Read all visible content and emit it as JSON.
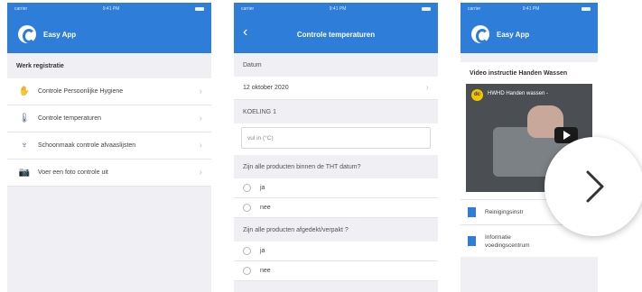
{
  "status": {
    "carrier": "carrier",
    "time": "9:41 PM"
  },
  "screen1": {
    "app_title": "Easy App",
    "section_header": "Werk registratie",
    "items": [
      {
        "label": "Controle Persoonlijke Hygiene",
        "icon": "hygiene-icon"
      },
      {
        "label": "Controle temperaturen",
        "icon": "thermometer-icon"
      },
      {
        "label": "Schoonmaak controle afvaaslijsten",
        "icon": "cleaning-icon"
      },
      {
        "label": "Voer een foto controle uit",
        "icon": "camera-icon"
      }
    ]
  },
  "screen2": {
    "nav_title": "Controle temperaturen",
    "datum_label": "Datum",
    "datum_value": "12 oktober 2020",
    "koeling_label": "KOELING 1",
    "koeling_placeholder": "vul in (°C)",
    "question1": "Zijn alle producten binnen de THT datum?",
    "options1": [
      "ja",
      "nee"
    ],
    "question2": "Zijn alle producten afgedekt/verpakt ?",
    "options2": [
      "ja",
      "nee"
    ]
  },
  "screen3": {
    "app_title": "Easy App",
    "card_title": "Video instructie Handen Wassen",
    "video_title": "HWHD Handen wassen -",
    "video_logo": "dc",
    "docs": [
      "Reinigingsinstr",
      "Informatie\nvoedingscentrum"
    ]
  },
  "colors": {
    "brand": "#2e7dd8",
    "background": "#efeff4"
  },
  "icons": {
    "back": "chevron-left-icon",
    "next": "chevron-right-icon",
    "play": "play-icon",
    "document": "document-icon"
  }
}
